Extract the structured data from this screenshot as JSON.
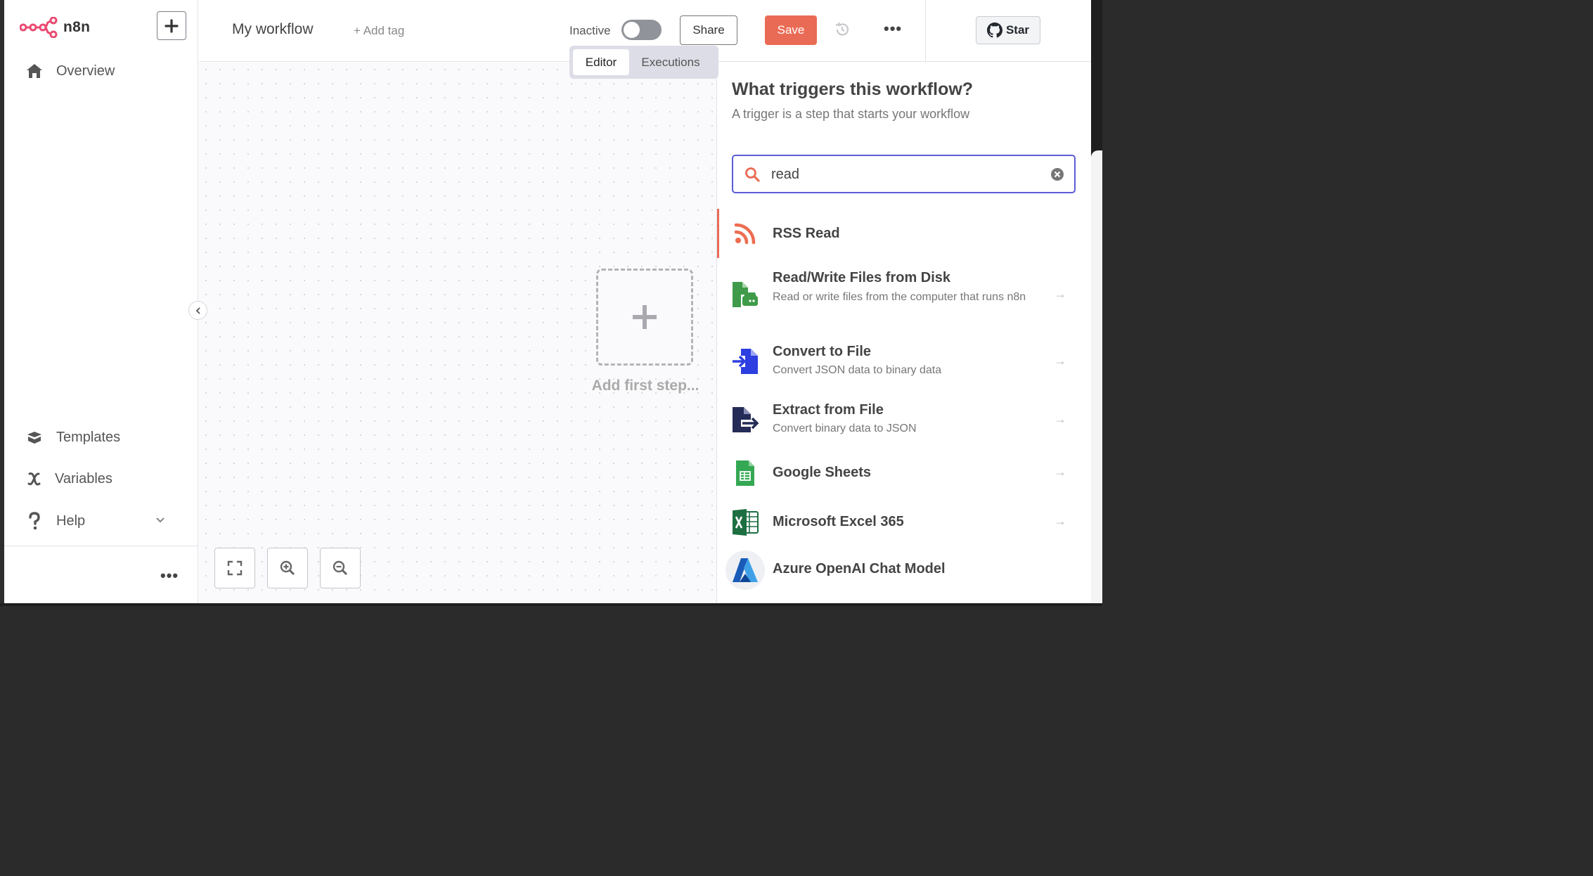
{
  "brand": {
    "name": "n8n",
    "accent": "#ea6b55"
  },
  "sidebar": {
    "overview": "Overview",
    "templates": "Templates",
    "variables": "Variables",
    "help": "Help",
    "more": "•••"
  },
  "header": {
    "workflow_name": "My workflow",
    "add_tag": "+ Add tag",
    "status_label": "Inactive",
    "active": false,
    "share": "Share",
    "save": "Save",
    "more": "•••",
    "star": "Star"
  },
  "tabs": [
    {
      "label": "Editor",
      "active": true
    },
    {
      "label": "Executions",
      "active": false
    }
  ],
  "canvas": {
    "add_first_step": "Add first step..."
  },
  "panel": {
    "title": "What triggers this workflow?",
    "subtitle": "A trigger is a step that starts your workflow",
    "search_value": "read",
    "nodes": [
      {
        "name": "RSS Read",
        "desc": "",
        "icon": "rss-icon",
        "selected": true
      },
      {
        "name": "Read/Write Files from Disk",
        "desc": "Read or write files from the computer that runs n8n",
        "icon": "disk-file-icon"
      },
      {
        "name": "Convert to File",
        "desc": "Convert JSON data to binary data",
        "icon": "convert-file-icon"
      },
      {
        "name": "Extract from File",
        "desc": "Convert binary data to JSON",
        "icon": "extract-file-icon"
      },
      {
        "name": "Google Sheets",
        "desc": "",
        "icon": "google-sheets-icon"
      },
      {
        "name": "Microsoft Excel 365",
        "desc": "",
        "icon": "excel-icon"
      },
      {
        "name": "Azure OpenAI Chat Model",
        "desc": "",
        "icon": "azure-openai-icon"
      }
    ]
  }
}
